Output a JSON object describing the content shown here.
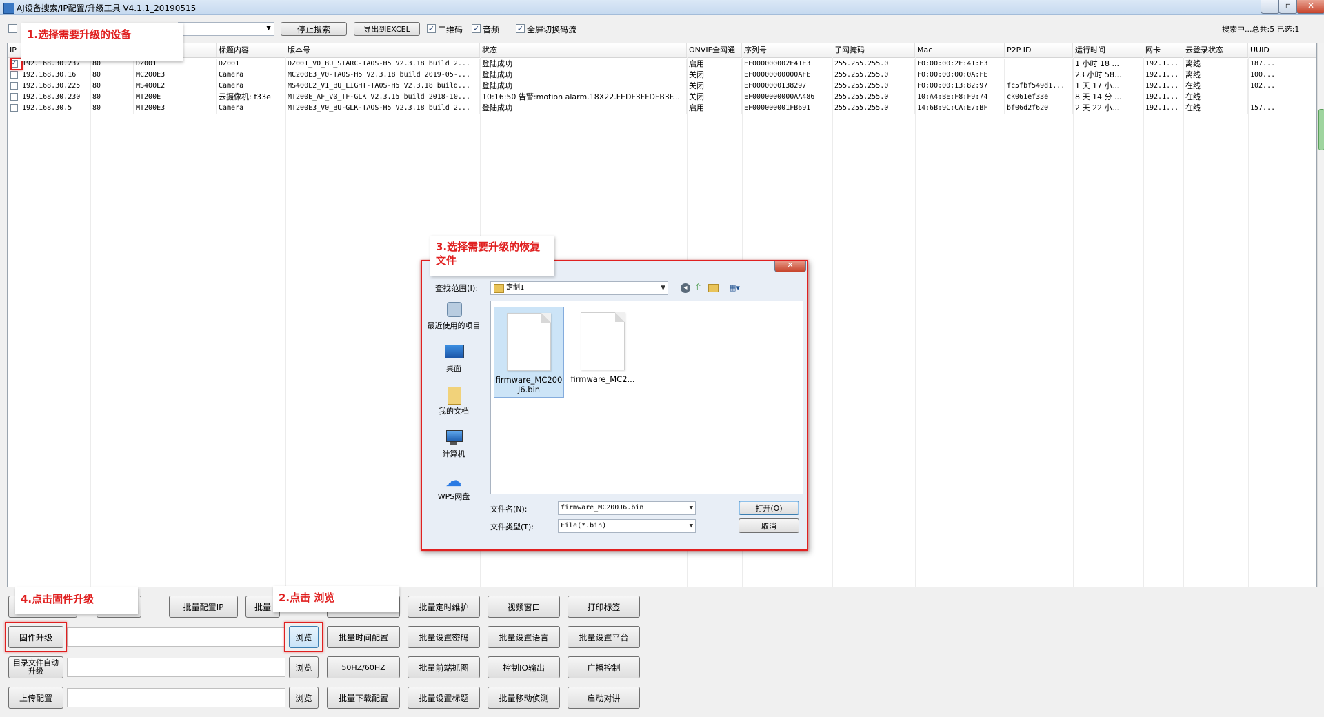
{
  "window": {
    "title": "AJ设备搜索/IP配置/升级工具 V4.1.1_20190515",
    "minimize": "–",
    "maximize": "▫",
    "close": "✕"
  },
  "toolbar": {
    "stop_search": "停止搜索",
    "export_excel": "导出到EXCEL",
    "qr_code": "二维码",
    "audio": "音频",
    "fullscreen_stream": "全屏切换码流",
    "status": "搜索中...总共:5 已选:1"
  },
  "table": {
    "columns": [
      "IP",
      "",
      "",
      "标题内容",
      "版本号",
      "状态",
      "ONVIF全网通",
      "序列号",
      "子网掩码",
      "Mac",
      "P2P ID",
      "运行时间",
      "网卡",
      "云登录状态",
      "UUID"
    ],
    "rows": [
      {
        "checked": true,
        "cells": [
          "192.168.30.237",
          "80",
          "DZ001",
          "DZ001",
          "DZ001_V0_BU_STARC-TAOS-H5 V2.3.18 build 2...",
          "登陆成功",
          "启用",
          "EF000000002E41E3",
          "255.255.255.0",
          "F0:00:00:2E:41:E3",
          "",
          "1 小时 18 ...",
          "192.1...",
          "离线",
          "187..."
        ]
      },
      {
        "checked": false,
        "cells": [
          "192.168.30.16",
          "80",
          "MC200E3",
          "Camera",
          "MC200E3_V0-TAOS-H5 V2.3.18 build 2019-05-...",
          "登陆成功",
          "关闭",
          "EF00000000000AFE",
          "255.255.255.0",
          "F0:00:00:00:0A:FE",
          "",
          "23 小时 58...",
          "192.1...",
          "离线",
          "100..."
        ]
      },
      {
        "checked": false,
        "cells": [
          "192.168.30.225",
          "80",
          "MS400L2",
          "Camera",
          "MS400L2_V1_BU_LIGHT-TAOS-H5 V2.3.18 build...",
          "登陆成功",
          "关闭",
          "EF0000000138297",
          "255.255.255.0",
          "F0:00:00:13:82:97",
          "fc5fbf549d1...",
          "1 天 17 小...",
          "192.1...",
          "在线",
          "102..."
        ]
      },
      {
        "checked": false,
        "cells": [
          "192.168.30.230",
          "80",
          "MT200E",
          "云摄像机: f33e",
          "MT200E_AF_V0_TF-GLK V2.3.15 build 2018-10...",
          "10:16:50 告警:motion alarm.18X22.FEDF3FFDFB3F...",
          "关闭",
          "EF0000000000AA486",
          "255.255.255.0",
          "10:A4:BE:F8:F9:74",
          "ck061ef33e",
          "8 天 14 分 ...",
          "192.1...",
          "在线",
          ""
        ]
      },
      {
        "checked": false,
        "cells": [
          "192.168.30.5",
          "80",
          "MT200E3",
          "Camera",
          "MT200E3_V0_BU-GLK-TAOS-H5 V2.3.18 build 2...",
          "登陆成功",
          "启用",
          "EF000000001FB691",
          "255.255.255.0",
          "14:6B:9C:CA:E7:BF",
          "bf06d2f620",
          "2 天 22 小...",
          "192.1...",
          "在线",
          "157..."
        ]
      }
    ]
  },
  "annotations": {
    "step1": "1.选择需要升级的设备",
    "step2": "2.点击 浏览",
    "step3": "3.选择需要升级的恢复文件",
    "step4": "4.点击固件升级"
  },
  "dialog": {
    "close": "✕",
    "look_in_label": "查找范围(I):",
    "look_in_value": "定制1",
    "places": [
      "最近使用的项目",
      "桌面",
      "我的文档",
      "计算机",
      "WPS网盘"
    ],
    "files": [
      {
        "name": "firmware_MC200J6.bin",
        "selected": true
      },
      {
        "name": "firmware_MC2...",
        "selected": false
      }
    ],
    "filename_label": "文件名(N):",
    "filename_value": "firmware_MC200J6.bin",
    "filetype_label": "文件类型(T):",
    "filetype_value": "File(*.bin)",
    "open": "打开(O)",
    "cancel": "取消"
  },
  "bottom": {
    "row1": [
      "批量配置IP",
      "批量",
      "批量定时维护",
      "视频窗口",
      "打印标签"
    ],
    "firmware_upgrade": "固件升级",
    "dir_auto_upgrade": "目录文件自动升级",
    "upload_config": "上传配置",
    "browse": "浏览",
    "row2": [
      "批量时间配置",
      "批量设置密码",
      "批量设置语言",
      "批量设置平台"
    ],
    "row3": [
      "50HZ/60HZ",
      "批量前端抓图",
      "控制IO输出",
      "广播控制"
    ],
    "row4": [
      "批量下载配置",
      "批量设置标题",
      "批量移动侦测",
      "启动对讲"
    ]
  },
  "colors": {
    "annotation": "#e02020",
    "selection": "#cce4f7"
  }
}
